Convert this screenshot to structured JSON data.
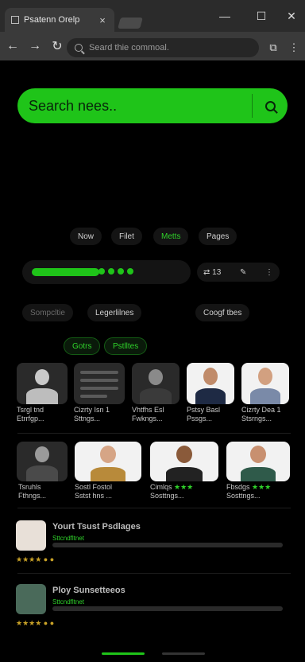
{
  "browser": {
    "tab_title": "Psatenn Orelp",
    "tab_close": "×",
    "address_placeholder": "Seard thie commoal.",
    "win_min": "—",
    "win_max": "☐",
    "win_close": "✕"
  },
  "search": {
    "placeholder": "Search nees.."
  },
  "filters": [
    {
      "label": "Now"
    },
    {
      "label": "Filet"
    },
    {
      "label": "Metts"
    },
    {
      "label": "Pages"
    }
  ],
  "status": {
    "count": "13",
    "progress": 0.45
  },
  "pills_row1": [
    "Sompcltie",
    "Legerlilnes",
    "Coogf tbes"
  ],
  "pills_row2": [
    "Gotrs",
    "Pstlltes"
  ],
  "cards_row1": [
    {
      "line1": "Tsrgl tnd",
      "line2": "Etrrfgp..."
    },
    {
      "line1": "Cizrty Isn 1",
      "line2": "Sttngs..."
    },
    {
      "line1": "Vhtfhs Esl",
      "line2": "Fwkngs..."
    },
    {
      "line1": "Pstsy Basl",
      "line2": "Pssgs..."
    },
    {
      "line1": "Cizrty Dea 1",
      "line2": "Stsrngs..."
    }
  ],
  "cards_row2": [
    {
      "line1": "Tsruhls",
      "line2": "Fthngs..."
    },
    {
      "line1": "Sostl Fostol",
      "line2": "Sstst hns ..."
    },
    {
      "line1": "Cimlqs",
      "stars": "★★★",
      "line2": "Sosttngs..."
    },
    {
      "line1": "Fbsdgs",
      "stars": "★★★",
      "line2": "Sosttngs..."
    }
  ],
  "list_rows": [
    {
      "title": "Yourt Tsust Psdlages",
      "sub": "Sttcndfltnet",
      "rating": "★★★★ ● ●"
    },
    {
      "title": "Ploy Sunsetteeos",
      "sub": "Sttcndfltnet",
      "rating": "★★★★ ● ●"
    }
  ]
}
